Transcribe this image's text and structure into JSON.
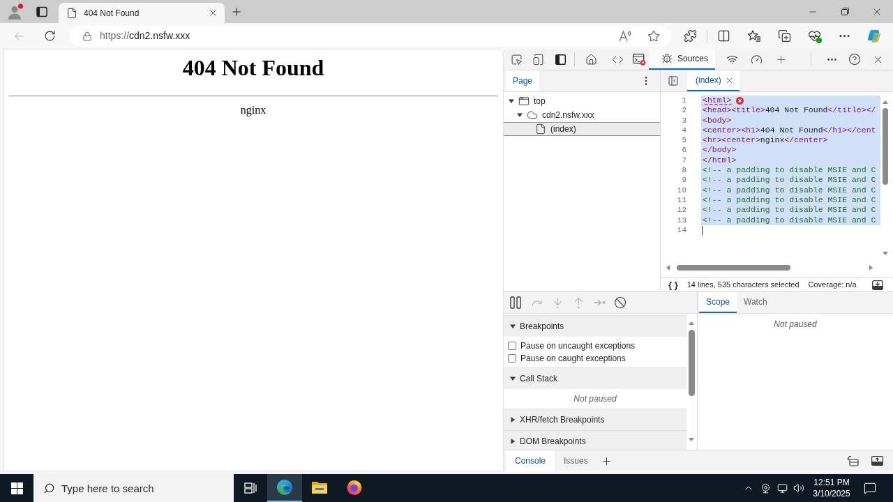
{
  "browser": {
    "profile": {
      "notification": true
    },
    "tabs": [
      {
        "title": "404 Not Found",
        "selected": true
      }
    ],
    "address": {
      "scheme": "https://",
      "host": "cdn2.nsfw.xxx"
    }
  },
  "page": {
    "heading": "404 Not Found",
    "footer": "nginx"
  },
  "devtools": {
    "toolbar_tabs": [
      {
        "label": "Sources",
        "selected": true
      }
    ],
    "navigator": {
      "tabs": [
        {
          "label": "Page",
          "selected": true
        }
      ],
      "tree": [
        {
          "label": "top",
          "kind": "frame",
          "expanded": true,
          "selected": false,
          "children": [
            {
              "label": "cdn2.nsfw.xxx",
              "kind": "domain",
              "expanded": true,
              "selected": false,
              "children": [
                {
                  "label": "(index)",
                  "kind": "file",
                  "selected": true
                }
              ]
            }
          ]
        }
      ]
    },
    "editor": {
      "tabs": [
        {
          "label": "(index)",
          "selected": true
        }
      ],
      "lines": [
        {
          "number": "1",
          "tokens": [
            {
              "kind": "tag",
              "text": "<html>"
            }
          ],
          "selected": true,
          "error": true,
          "cursor": false
        },
        {
          "number": "2",
          "tokens": [
            {
              "kind": "tag",
              "text": "<head><title>"
            },
            {
              "kind": "text",
              "text": "404 Not Found"
            },
            {
              "kind": "tag",
              "text": "</title></"
            }
          ],
          "selected": true,
          "error": false,
          "cursor": false
        },
        {
          "number": "3",
          "tokens": [
            {
              "kind": "tag",
              "text": "<body>"
            }
          ],
          "selected": true,
          "error": false,
          "cursor": false
        },
        {
          "number": "4",
          "tokens": [
            {
              "kind": "tag",
              "text": "<center><h1>"
            },
            {
              "kind": "text",
              "text": "404 Not Found"
            },
            {
              "kind": "tag",
              "text": "</h1></cent"
            }
          ],
          "selected": true,
          "error": false,
          "cursor": false
        },
        {
          "number": "5",
          "tokens": [
            {
              "kind": "tag",
              "text": "<hr><center>"
            },
            {
              "kind": "text",
              "text": "nginx"
            },
            {
              "kind": "tag",
              "text": "</center>"
            }
          ],
          "selected": true,
          "error": false,
          "cursor": false
        },
        {
          "number": "6",
          "tokens": [
            {
              "kind": "tag",
              "text": "</body>"
            }
          ],
          "selected": true,
          "error": false,
          "cursor": false
        },
        {
          "number": "7",
          "tokens": [
            {
              "kind": "tag",
              "text": "</html>"
            }
          ],
          "selected": true,
          "error": false,
          "cursor": false
        },
        {
          "number": "8",
          "tokens": [
            {
              "kind": "comment",
              "text": "<!-- a padding to disable MSIE and C"
            }
          ],
          "selected": true,
          "error": false,
          "cursor": false
        },
        {
          "number": "9",
          "tokens": [
            {
              "kind": "comment",
              "text": "<!-- a padding to disable MSIE and C"
            }
          ],
          "selected": true,
          "error": false,
          "cursor": false
        },
        {
          "number": "10",
          "tokens": [
            {
              "kind": "comment",
              "text": "<!-- a padding to disable MSIE and C"
            }
          ],
          "selected": true,
          "error": false,
          "cursor": false
        },
        {
          "number": "11",
          "tokens": [
            {
              "kind": "comment",
              "text": "<!-- a padding to disable MSIE and C"
            }
          ],
          "selected": true,
          "error": false,
          "cursor": false
        },
        {
          "number": "12",
          "tokens": [
            {
              "kind": "comment",
              "text": "<!-- a padding to disable MSIE and C"
            }
          ],
          "selected": true,
          "error": false,
          "cursor": false
        },
        {
          "number": "13",
          "tokens": [
            {
              "kind": "comment",
              "text": "<!-- a padding to disable MSIE and C"
            }
          ],
          "selected": true,
          "error": false,
          "cursor": false
        },
        {
          "number": "14",
          "selected": false,
          "error": false,
          "cursor": true
        }
      ],
      "status": {
        "format": "{ }",
        "selection": "14 lines, 535 characters selected",
        "coverage": "Coverage: n/a"
      }
    },
    "debugger": {
      "controls": [
        {
          "kind": "pause",
          "disabled": false
        },
        {
          "kind": "step_over",
          "disabled": true
        },
        {
          "kind": "step_into",
          "disabled": true
        },
        {
          "kind": "step_out",
          "disabled": true
        },
        {
          "kind": "step",
          "disabled": true
        },
        {
          "kind": "deactivate",
          "disabled": false
        }
      ],
      "sections": [
        {
          "title": "Breakpoints",
          "expanded": true,
          "kind": "checkboxes",
          "options": [
            {
              "label": "Pause on uncaught exceptions",
              "checked": false
            },
            {
              "label": "Pause on caught exceptions",
              "checked": false
            }
          ]
        },
        {
          "title": "Call Stack",
          "expanded": true,
          "kind": "message",
          "message": "Not paused"
        },
        {
          "title": "XHR/fetch Breakpoints",
          "expanded": false
        },
        {
          "title": "DOM Breakpoints",
          "expanded": false
        }
      ],
      "side_tabs": [
        {
          "label": "Scope",
          "selected": true
        },
        {
          "label": "Watch",
          "selected": false
        }
      ],
      "side_message": "Not paused"
    },
    "drawer": {
      "tabs": [
        {
          "label": "Console",
          "selected": true
        },
        {
          "label": "Issues",
          "selected": false
        }
      ]
    }
  },
  "taskbar": {
    "search_placeholder": "Type here to search",
    "apps": [
      {
        "kind": "edge",
        "selected": true
      },
      {
        "kind": "explorer",
        "selected": false
      },
      {
        "kind": "firefox",
        "selected": false
      }
    ],
    "time": "12:51 PM",
    "date": "3/10/2025"
  }
}
